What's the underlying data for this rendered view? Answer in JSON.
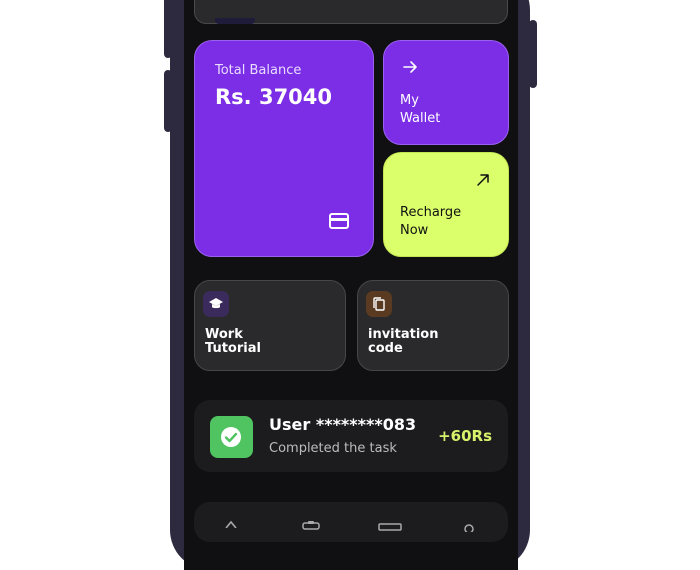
{
  "balance": {
    "label": "Total Balance",
    "amount": "Rs. 37040",
    "icon": "credit-card-icon"
  },
  "quick_actions": {
    "wallet": {
      "line1": "My",
      "line2": "Wallet",
      "icon": "arrow-right-icon"
    },
    "recharge": {
      "line1": "Recharge",
      "line2": "Now",
      "icon": "arrow-up-right-icon"
    }
  },
  "tiles": [
    {
      "line1": "Work",
      "line2": "Tutorial",
      "icon": "graduation-cap-icon",
      "icon_bg": "#3a2b5c"
    },
    {
      "line1": "invitation",
      "line2": "code",
      "icon": "copy-icon",
      "icon_bg": "#5a3b22"
    }
  ],
  "activity": {
    "user": "User ********083",
    "status": "Completed the task",
    "reward": "+60Rs",
    "icon": "check-circle-icon"
  },
  "colors": {
    "accent_purple": "#7b2ee6",
    "accent_lime": "#dbff6b",
    "background": "#101012",
    "success_green": "#4fc460"
  }
}
